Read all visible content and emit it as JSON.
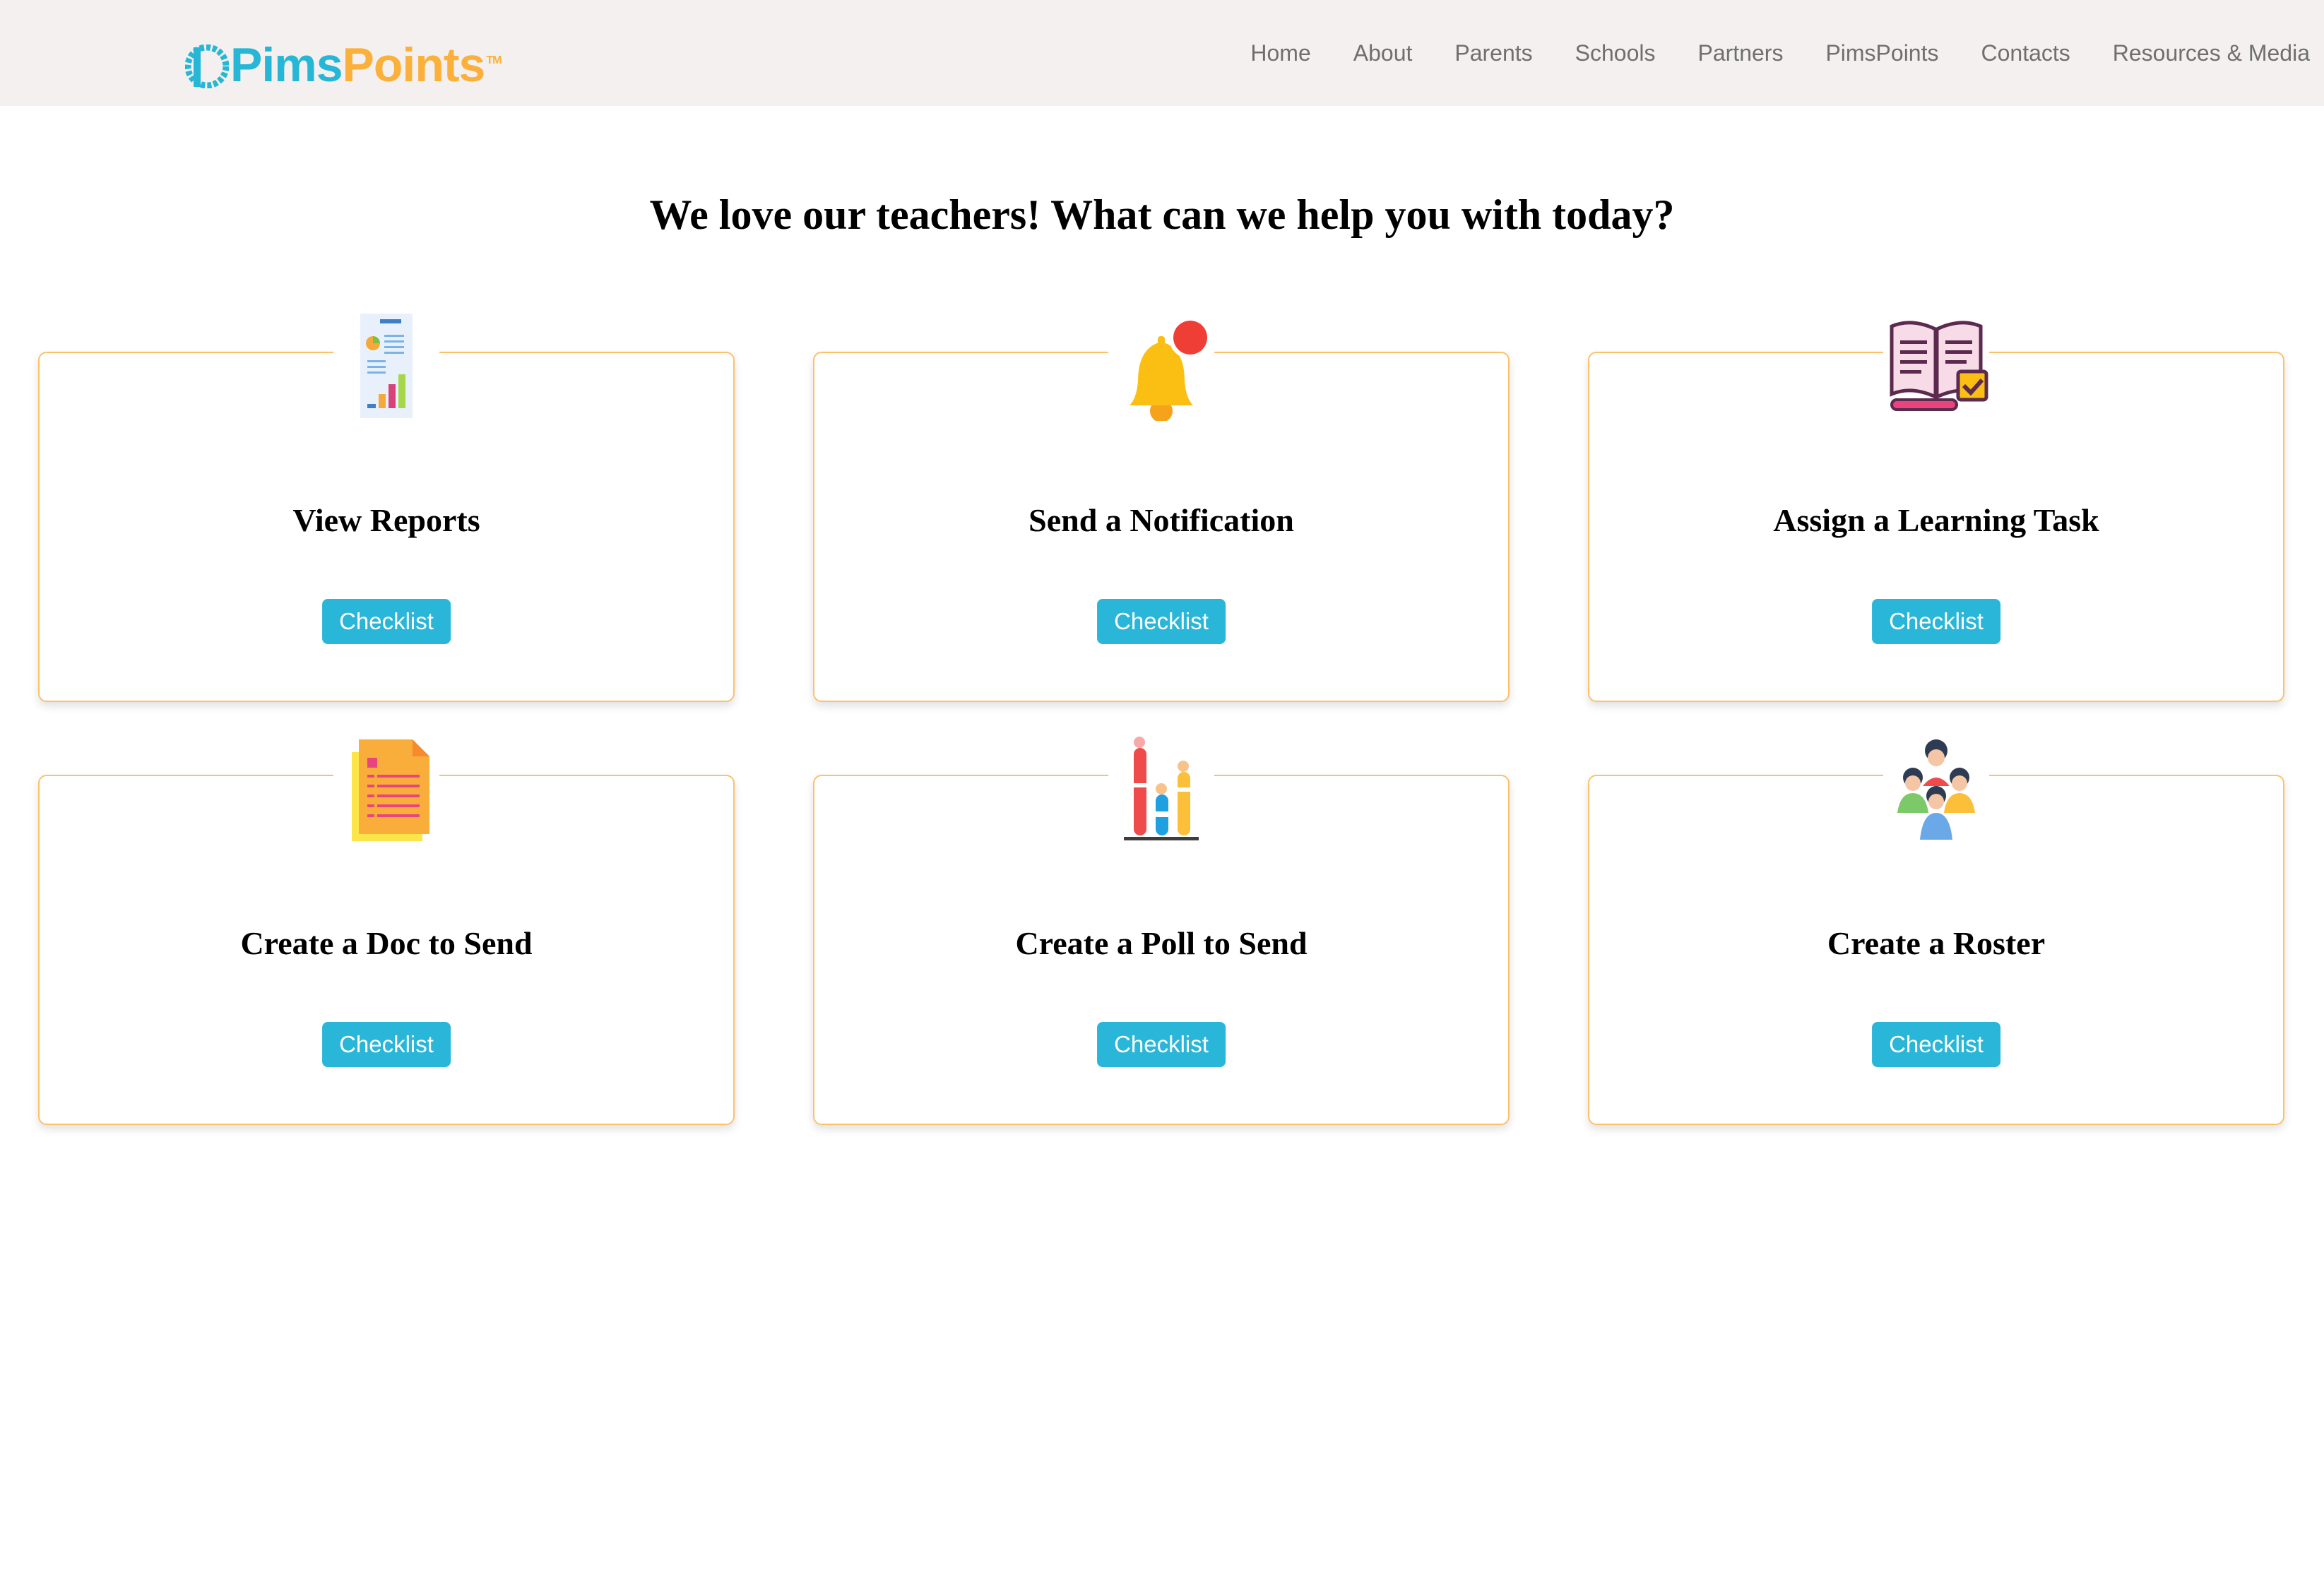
{
  "header": {
    "logo": {
      "part1": "Pims",
      "part2": "Points",
      "tm": "TM"
    },
    "nav": [
      "Home",
      "About",
      "Parents",
      "Schools",
      "Partners",
      "PimsPoints",
      "Contacts",
      "Resources & Media"
    ]
  },
  "main": {
    "headline": "We love our teachers! What can we help you with today?"
  },
  "cards": [
    {
      "title": "View Reports",
      "button": "Checklist",
      "icon": "report-icon"
    },
    {
      "title": "Send a Notification",
      "button": "Checklist",
      "icon": "bell-notification-icon"
    },
    {
      "title": "Assign a Learning Task",
      "button": "Checklist",
      "icon": "open-book-task-icon"
    },
    {
      "title": "Create a Doc to Send",
      "button": "Checklist",
      "icon": "document-icon"
    },
    {
      "title": "Create a Poll to Send",
      "button": "Checklist",
      "icon": "poll-chart-icon"
    },
    {
      "title": "Create a Roster",
      "button": "Checklist",
      "icon": "group-people-icon"
    }
  ],
  "colors": {
    "header_bg": "#f3f0ef",
    "brand_blue": "#27b7d6",
    "brand_orange": "#fbb03b",
    "button_bg": "#29b6d8",
    "card_border": "#fbc26a"
  }
}
